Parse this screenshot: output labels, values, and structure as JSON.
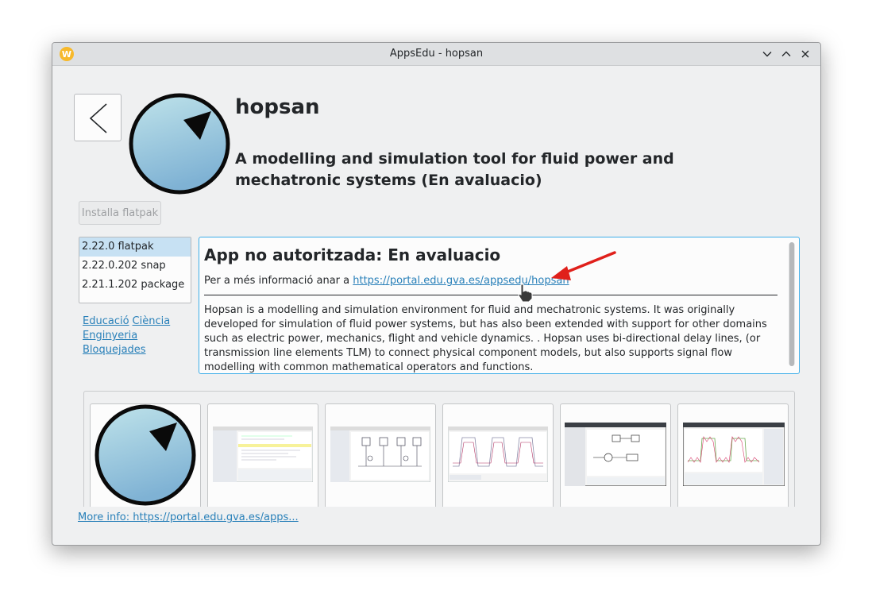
{
  "window": {
    "title": "AppsEdu - hopsan",
    "app_icon_letter": "W"
  },
  "app": {
    "name": "hopsan",
    "summary": "A modelling and simulation tool for fluid power and mechatronic systems (En avaluacio)",
    "install_button": "Installa flatpak"
  },
  "versions": [
    "2.22.0 flatpak",
    "2.22.0.202 snap",
    "2.21.1.202 package"
  ],
  "categories": [
    "Educació",
    "Ciència",
    "Enginyeria",
    "Bloquejades"
  ],
  "detail": {
    "title": "App no autoritzada: En avaluacio",
    "info_prefix": "Per a més informació anar a ",
    "info_link": "https://portal.edu.gva.es/appsedu/hopsan",
    "description": "Hopsan is a modelling and simulation environment for fluid and mechatronic systems. It was originally developed for simulation of fluid power systems, but has also been extended with support for other domains such as electric power, mechanics, flight and vehicle dynamics. . Hopsan uses bi-directional delay lines, (or transmission line elements TLM) to connect physical component models, but also supports signal flow modelling with common mathematical operators and functions."
  },
  "more_info": "More info: https://portal.edu.gva.es/apps...",
  "colors": {
    "accent": "#3daee9",
    "link": "#2980b9",
    "arrow": "#e0201b",
    "selection": "#c7e1f3"
  }
}
